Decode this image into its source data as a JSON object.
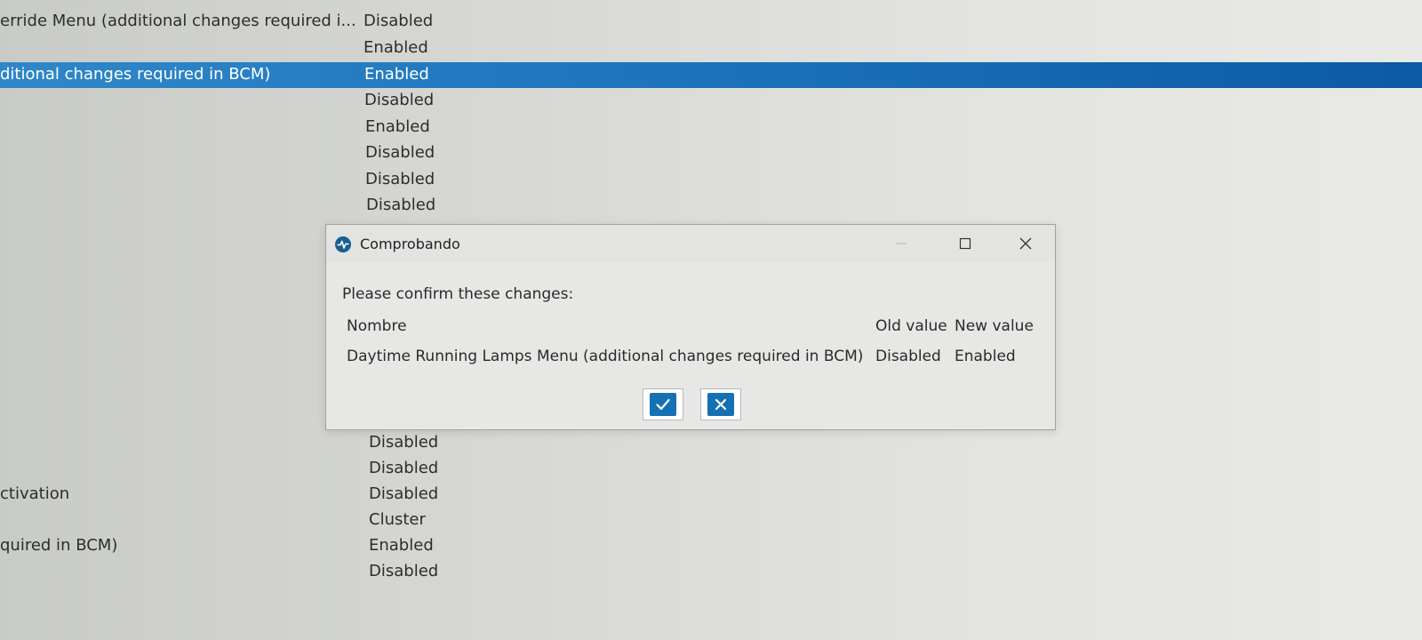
{
  "list": {
    "rows": [
      {
        "name": "erride Menu (additional changes required i...",
        "value": "Disabled",
        "selected": false
      },
      {
        "name": "",
        "value": "Enabled",
        "selected": false
      },
      {
        "name": "ditional changes required in BCM)",
        "value": "Enabled",
        "selected": true
      },
      {
        "name": "",
        "value": "Disabled",
        "selected": false
      },
      {
        "name": "",
        "value": "Enabled",
        "selected": false
      },
      {
        "name": "",
        "value": "Disabled",
        "selected": false
      },
      {
        "name": "",
        "value": "Disabled",
        "selected": false
      },
      {
        "name": "",
        "value": "Disabled",
        "selected": false
      }
    ],
    "lower_rows": [
      {
        "name": "",
        "value": "Disabled"
      },
      {
        "name": "",
        "value": "Disabled"
      },
      {
        "name": "ctivation",
        "value": "Disabled"
      },
      {
        "name": "",
        "value": "Cluster"
      },
      {
        "name": "quired in BCM)",
        "value": "Enabled"
      },
      {
        "name": "",
        "value": "Disabled"
      }
    ]
  },
  "dialog": {
    "title": "Comprobando",
    "prompt": "Please confirm these changes:",
    "columns": {
      "name": "Nombre",
      "old_value": "Old value",
      "new_value": "New value"
    },
    "changes": [
      {
        "name": "Daytime Running Lamps Menu (additional changes required in BCM)",
        "old_value": "Disabled",
        "new_value": "Enabled"
      }
    ]
  },
  "colors": {
    "selection": "#1f74bd",
    "action_button": "#1571b4"
  },
  "icons": {
    "app": "pulse-circle-icon",
    "confirm": "checkmark-icon",
    "cancel": "x-icon"
  }
}
